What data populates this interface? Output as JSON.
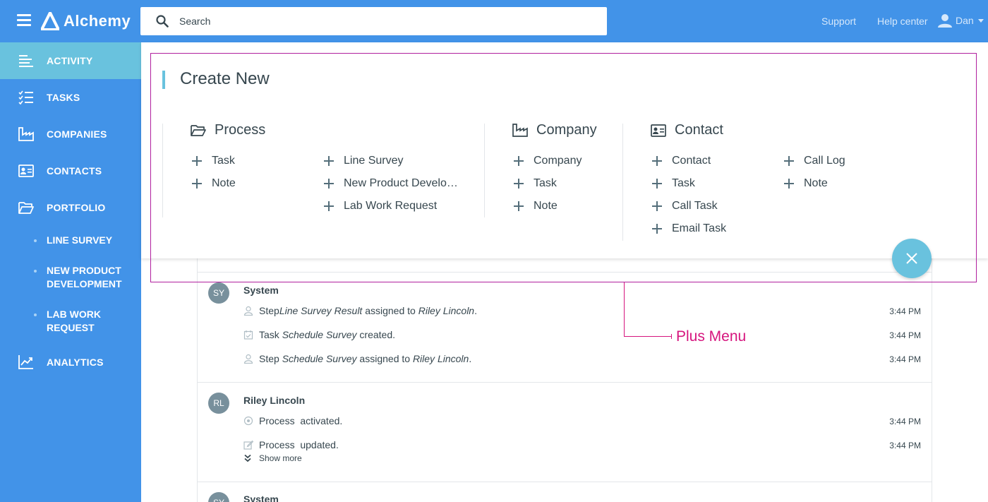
{
  "app": {
    "name": "Alchemy"
  },
  "header": {
    "search_placeholder": "Search",
    "links": [
      "Support",
      "Help center"
    ],
    "user": "Dan"
  },
  "sidebar": {
    "items": [
      {
        "label": "ACTIVITY",
        "icon": "activity-icon",
        "active": true
      },
      {
        "label": "TASKS",
        "icon": "tasks-icon"
      },
      {
        "label": "COMPANIES",
        "icon": "companies-icon"
      },
      {
        "label": "CONTACTS",
        "icon": "contacts-icon"
      },
      {
        "label": "PORTFOLIO",
        "icon": "folder-icon"
      },
      {
        "label": "ANALYTICS",
        "icon": "analytics-icon"
      }
    ],
    "portfolio_sub": [
      "LINE SURVEY",
      "NEW PRODUCT DEVELOPMENT",
      "LAB WORK REQUEST"
    ]
  },
  "create_panel": {
    "title": "Create New",
    "process": {
      "heading": "Process",
      "col1": [
        "Task",
        "Note"
      ],
      "col2": [
        "Line Survey",
        "New Product Develo…",
        "Lab Work Request"
      ]
    },
    "company": {
      "heading": "Company",
      "items": [
        "Company",
        "Task",
        "Note"
      ]
    },
    "contact": {
      "heading": "Contact",
      "col1": [
        "Contact",
        "Task",
        "Call Task",
        "Email Task"
      ],
      "col2": [
        "Call Log",
        "Note"
      ]
    }
  },
  "feed": {
    "groups": [
      {
        "initials": "SY",
        "name": "System",
        "lines": [
          {
            "icon": "user-icon",
            "parts": [
              "Step ",
              "Line Survey Result",
              " assigned to ",
              "Riley Lincoln",
              "."
            ],
            "time": "3:44 PM"
          },
          {
            "icon": "calendar-check-icon",
            "parts": [
              "Task ",
              "Schedule Survey",
              " created."
            ],
            "time": "3:44 PM"
          },
          {
            "icon": "user-icon",
            "parts": [
              "Step ",
              "Schedule Survey",
              " assigned to ",
              "Riley Lincoln",
              "."
            ],
            "time": "3:44 PM"
          }
        ]
      },
      {
        "initials": "RL",
        "name": "Riley Lincoln",
        "lines": [
          {
            "icon": "circle-dot-icon",
            "text": "Process  activated.",
            "time": "3:44 PM"
          },
          {
            "icon": "edit-icon",
            "text": "Process  updated.",
            "time": "3:44 PM"
          }
        ],
        "show_more": "Show more"
      },
      {
        "initials": "SY",
        "name": "System"
      }
    ]
  },
  "annotation": {
    "label": "Plus Menu"
  }
}
